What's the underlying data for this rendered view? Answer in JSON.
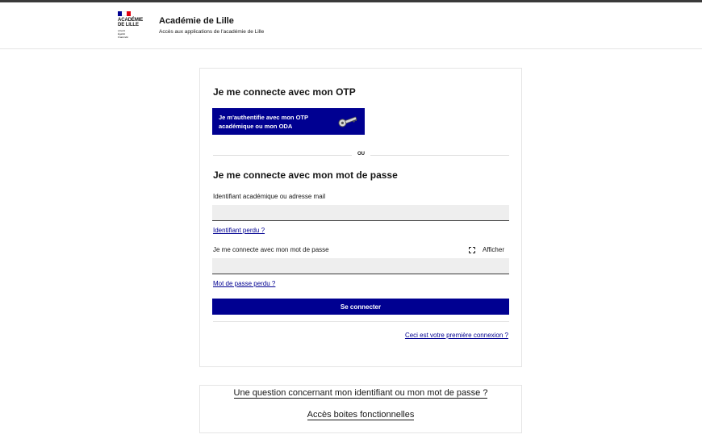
{
  "header": {
    "logo_text": "ACADÉMIE\nDE LILLE",
    "logo_motto": "Liberté\nÉgalité\nFraternité",
    "title": "Académie de Lille",
    "subtitle": "Accès aux applications de l'académie de Lille"
  },
  "otp_section": {
    "heading": "Je me connecte avec mon OTP",
    "button_label": "Je m'authentifie avec mon OTP académique ou mon ODA",
    "icon": "key-icon"
  },
  "separator": {
    "label": "OU"
  },
  "password_section": {
    "heading": "Je me connecte avec mon mot de passe",
    "id_label": "Identifiant académique ou adresse mail",
    "id_value": "",
    "lost_id_link": "Identifiant perdu ?",
    "pw_label": "Je me connecte avec mon mot de passe",
    "pw_value": "",
    "show_label": "Afficher",
    "lost_pw_link": "Mot de passe perdu ?",
    "submit_label": "Se connecter",
    "first_connection_link": "Ceci est votre première connexion ?"
  },
  "help": {
    "question_link": "Une question concernant mon identifiant ou mon mot de passe ?",
    "functional_link": "Accès boites fonctionnelles"
  },
  "colors": {
    "primary": "#000091",
    "flag_blue": "#000091",
    "flag_white": "#ffffff",
    "flag_red": "#e1000f"
  }
}
